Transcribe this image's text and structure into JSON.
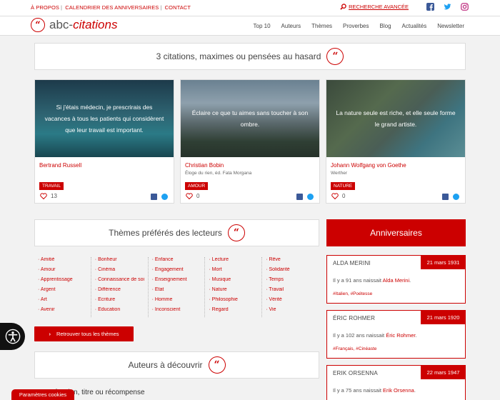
{
  "topbar": {
    "links": [
      "À PROPOS",
      "CALENDRIER DES ANNIVERSAIRES",
      "CONTACT"
    ],
    "advanced_search": "RECHERCHE AVANCÉE",
    "social_icons": [
      "facebook-icon",
      "twitter-icon",
      "instagram-icon"
    ]
  },
  "header": {
    "logo_prefix": "abc-",
    "logo_accent": "citations",
    "nav": [
      "Top 10",
      "Auteurs",
      "Thèmes",
      "Proverbes",
      "Blog",
      "Actualités",
      "Newsletter"
    ]
  },
  "random_section": {
    "title": "3 citations, maximes ou pensées au hasard"
  },
  "cards": [
    {
      "quote": "Si j'étais médecin, je prescrirais des vacances à tous les patients qui considèrent que leur travail est important.",
      "author": "Bertrand Russell",
      "source": "",
      "tag": "TRAVAIL",
      "likes": "13"
    },
    {
      "quote": "Éclaire ce que tu aimes sans toucher à son ombre.",
      "author": "Christian Bobin",
      "source": "Éloge du rien, éd. Fata Morgana",
      "tag": "AMOUR",
      "likes": "0"
    },
    {
      "quote": "La nature seule est riche, et elle seule forme le grand artiste.",
      "author": "Johann Wolfgang von Goethe",
      "source": "Werther",
      "tag": "NATURE",
      "likes": "0"
    }
  ],
  "themes_section": {
    "title": "Thèmes préférés des lecteurs",
    "columns": [
      [
        "Amitié",
        "Amour",
        "Apprentissage",
        "Argent",
        "Art",
        "Avenir"
      ],
      [
        "Bonheur",
        "Cinéma",
        "Connaissance de soi",
        "Différence",
        "Écriture",
        "Éducation"
      ],
      [
        "Enfance",
        "Engagement",
        "Enseignement",
        "État",
        "Homme",
        "Inconscient"
      ],
      [
        "Lecture",
        "Mort",
        "Musique",
        "Nature",
        "Philosophie",
        "Regard"
      ],
      [
        "Rêve",
        "Solidarité",
        "Temps",
        "Travail",
        "Vérité",
        "Vie"
      ]
    ],
    "button": "Retrouver tous les thèmes"
  },
  "authors_section": {
    "title": "Auteurs à découvrir",
    "subheading": "...r profession, titre ou récompense"
  },
  "anniversaries": {
    "title": "Anniversaires",
    "items": [
      {
        "name": "ALDA MERINI",
        "date": "21 mars 1931",
        "prefix": "Il y a 91 ans naissait ",
        "link": "Alda Merini",
        "tags": "#Italien, #Poétesse"
      },
      {
        "name": "ÉRIC ROHMER",
        "date": "21 mars 1920",
        "prefix": "Il y a 102 ans naissait ",
        "link": "Éric Rohmer",
        "tags": "#Français, #Cinéaste"
      },
      {
        "name": "ERIK ORSENNA",
        "date": "22 mars 1947",
        "prefix": "Il y a 75 ans naissait ",
        "link": "Erik Orsenna",
        "tags": ""
      }
    ]
  },
  "cookies": "Paramètres cookies",
  "colors": {
    "accent": "#cc0000",
    "facebook": "#3b5998",
    "twitter": "#1da1f2",
    "instagram": "#c13584"
  }
}
